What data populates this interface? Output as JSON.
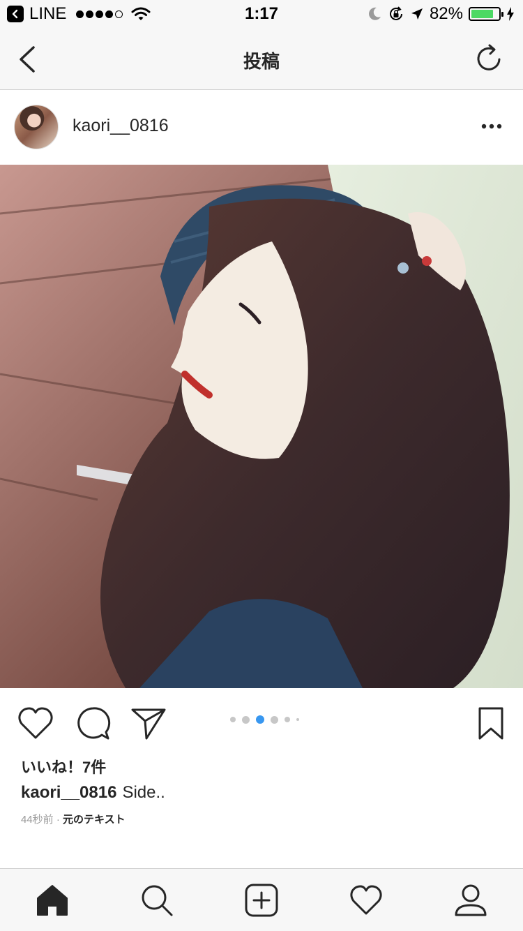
{
  "status_bar": {
    "app_name": "LINE",
    "time": "1:17",
    "battery_percent": "82%",
    "battery_level": 0.82,
    "signal_bars_filled": 4,
    "signal_bars_total": 5
  },
  "nav": {
    "title": "投稿",
    "back_icon": "chevron-left-icon",
    "refresh_icon": "refresh-icon"
  },
  "post": {
    "username": "kaori__0816",
    "more_icon": "ellipsis-icon",
    "carousel": {
      "total": 6,
      "active_index": 2
    },
    "likes_text": "いいね！7件",
    "caption_user": "kaori__0816",
    "caption_text": "Side..",
    "timestamp": "44秒前",
    "separator": " · ",
    "original_text_link": "元のテキスト"
  },
  "tab_bar": {
    "items": [
      {
        "icon": "home-icon",
        "active": true
      },
      {
        "icon": "search-icon",
        "active": false
      },
      {
        "icon": "add-post-icon",
        "active": false
      },
      {
        "icon": "heart-icon",
        "active": false
      },
      {
        "icon": "profile-icon",
        "active": false
      }
    ]
  },
  "colors": {
    "accent_blue": "#3897f0",
    "battery_green": "#4cd964",
    "text": "#262626",
    "muted": "#999999"
  }
}
